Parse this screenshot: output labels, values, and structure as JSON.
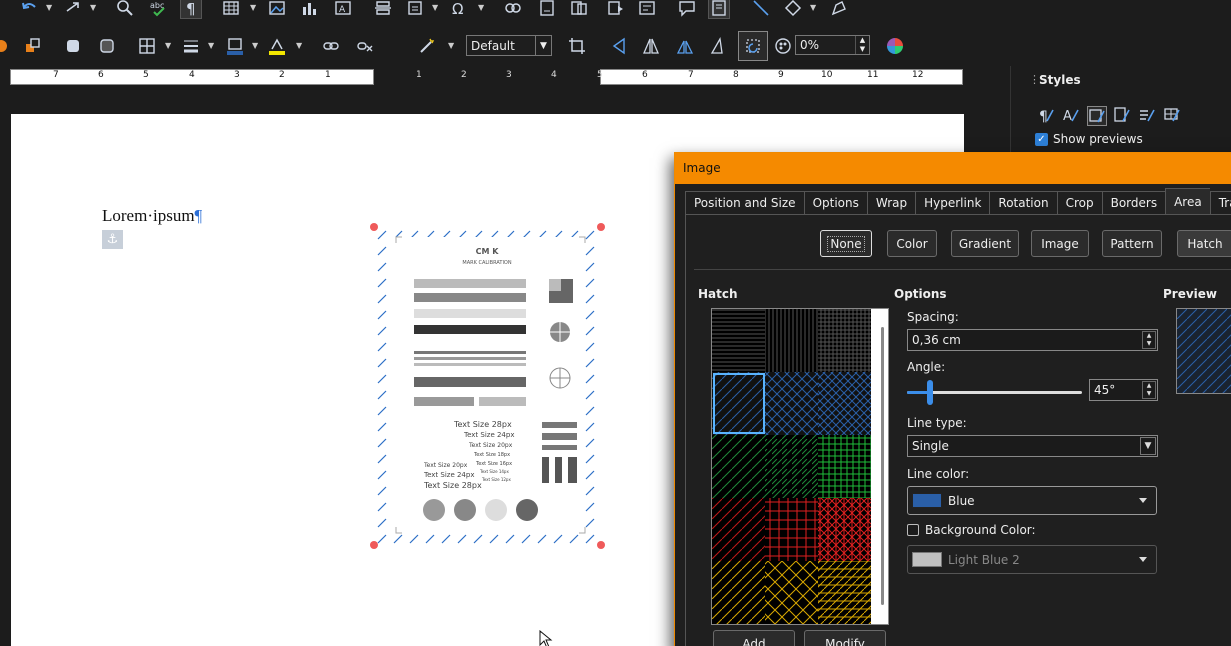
{
  "toolbar": {
    "style_select": "Default",
    "transparency_value": "0%"
  },
  "ruler": {
    "left_numbers": [
      "7",
      "6",
      "5",
      "4",
      "3",
      "2",
      "1"
    ],
    "right_numbers": [
      "1",
      "2",
      "3",
      "4",
      "5",
      "6",
      "7",
      "8",
      "9",
      "10",
      "11",
      "12"
    ]
  },
  "document": {
    "text": "Lorem·ipsum",
    "pilcrow": "¶",
    "image_content": {
      "title": "CM  K",
      "subtitle": "MARK CALIBRATION",
      "text_sizes": [
        "Text Size 28px",
        "Text Size 24px",
        "Text Size 20px",
        "Text Size 18px",
        "Text Size 16px",
        "Text Size 14px",
        "Text Size 12px",
        "Text Size 20px",
        "Text Size 24px",
        "Text Size 28px"
      ]
    }
  },
  "sidebar": {
    "title": "Styles",
    "show_previews": "Show previews"
  },
  "dialog": {
    "title": "Image",
    "tabs": [
      "Position and Size",
      "Options",
      "Wrap",
      "Hyperlink",
      "Rotation",
      "Crop",
      "Borders",
      "Area",
      "Transp"
    ],
    "active_tab": "Area",
    "fill_buttons": [
      "None",
      "Color",
      "Gradient",
      "Image",
      "Pattern",
      "Hatch"
    ],
    "hatch_label": "Hatch",
    "options_label": "Options",
    "preview_label": "Preview",
    "spacing_label": "Spacing:",
    "spacing_value": "0,36 cm",
    "angle_label": "Angle:",
    "angle_value": "45°",
    "angle_slider_fraction": 0.125,
    "line_type_label": "Line type:",
    "line_type_value": "Single",
    "line_color_label": "Line color:",
    "line_color_value": "Blue",
    "line_color_hex": "#2a5fa8",
    "bg_color_label": "Background Color:",
    "bg_color_value": "Light Blue 2",
    "bg_color_hex": "#c0c0c0",
    "add_button": "Add",
    "modify_button": "Modify"
  },
  "colors": {
    "accent": "#f58a00",
    "selection": "#3b8eea"
  }
}
